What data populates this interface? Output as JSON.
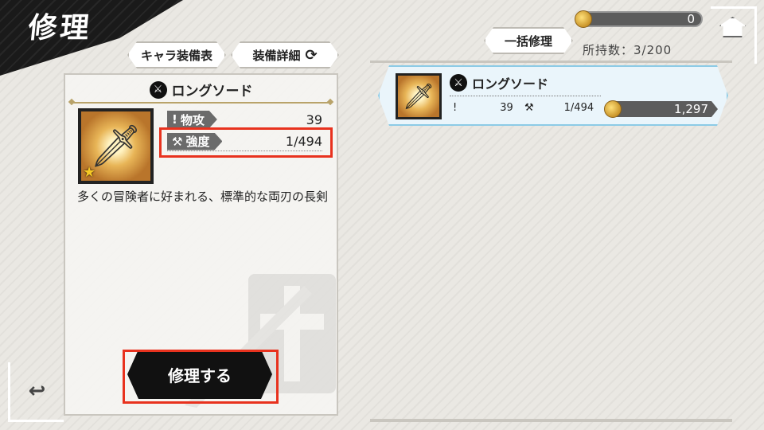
{
  "header": {
    "title": "修理"
  },
  "tabs": {
    "equipment_table": "キャラ装備表",
    "equipment_detail": "装備詳細"
  },
  "currency": {
    "amount": "0",
    "icon": "coin-icon"
  },
  "actions": {
    "bulk_repair": "一括修理",
    "repair": "修理する"
  },
  "owned": {
    "label": "所持数：3/200"
  },
  "selected_item": {
    "name": "ロングソード",
    "stats": [
      {
        "label": "物攻",
        "value": "39",
        "icon": "attack-icon"
      },
      {
        "label": "強度",
        "value": "1/494",
        "icon": "durability-icon"
      }
    ],
    "description": "多くの冒険者に好まれる、標準的な両刃の長剣",
    "rarity_icon": "star-icon"
  },
  "list": [
    {
      "name": "ロングソード",
      "attack": "39",
      "durability": "1/494",
      "cost": "1,297"
    }
  ],
  "colors": {
    "highlight": "#e8321e",
    "accent_blue": "#8ccbe6",
    "dark": "#111111"
  }
}
